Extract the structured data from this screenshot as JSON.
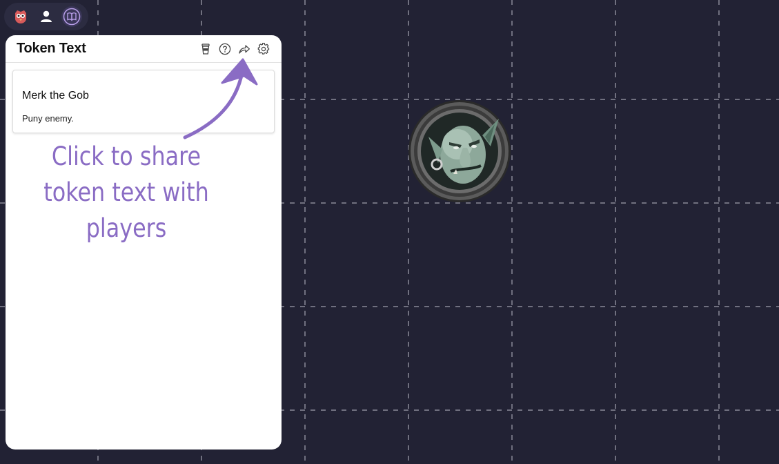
{
  "toolbar": {
    "buttons": [
      {
        "name": "owlbear-logo-icon",
        "active": false
      },
      {
        "name": "player-icon",
        "active": false
      },
      {
        "name": "book-icon",
        "active": true
      }
    ]
  },
  "panel": {
    "title": "Token Text",
    "header_icons": [
      "coffee-cup-icon",
      "help-icon",
      "share-icon",
      "gear-icon"
    ],
    "token": {
      "name": "Merk the Gob",
      "description": "Puny enemy."
    }
  },
  "annotation": {
    "text": "Click to share token text with players",
    "color": "#8a6cc4"
  },
  "map": {
    "background": "#222234",
    "grid_color": "#8a8a98",
    "token_icon": "goblin-token-icon"
  }
}
